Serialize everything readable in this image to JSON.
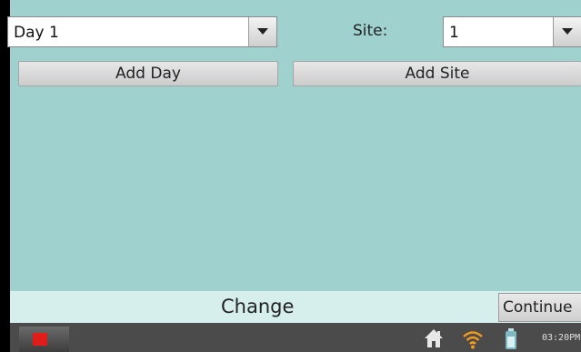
{
  "selectors": {
    "day_value": "Day 1",
    "site_label": "Site:",
    "site_value": "1"
  },
  "buttons": {
    "add_day": "Add Day",
    "add_site": "Add Site",
    "continue": "Continue"
  },
  "footer": {
    "change_label": "Change"
  },
  "taskbar": {
    "clock": "03:20PM",
    "icons": [
      "stop-icon",
      "home-icon",
      "wifi-icon",
      "battery-icon"
    ]
  },
  "colors": {
    "panel_bg": "#9fd1cf",
    "change_bar_bg": "#d6eeec",
    "taskbar_bg": "#4b4b4b",
    "stop_red": "#e21b1b",
    "wifi_orange": "#f39a1e"
  }
}
